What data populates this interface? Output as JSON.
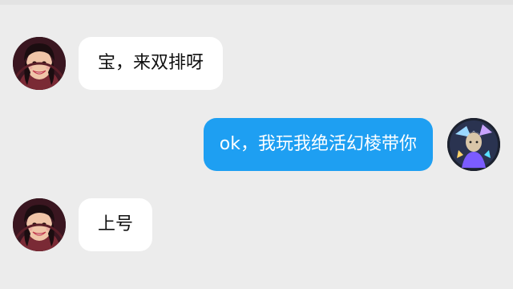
{
  "colors": {
    "background": "#ececec",
    "incoming_bubble": "#ffffff",
    "outgoing_bubble": "#1e9ff2",
    "outgoing_text": "#ffffff",
    "incoming_text": "#111111"
  },
  "messages": [
    {
      "side": "left",
      "sender": "friend",
      "text": "宝，来双排呀"
    },
    {
      "side": "right",
      "sender": "me",
      "text": "ok，我玩我绝活幻棱带你"
    },
    {
      "side": "left",
      "sender": "friend",
      "text": "上号"
    }
  ],
  "avatars": {
    "friend": "avatar-woman-icon",
    "me": "avatar-game-character-icon"
  }
}
